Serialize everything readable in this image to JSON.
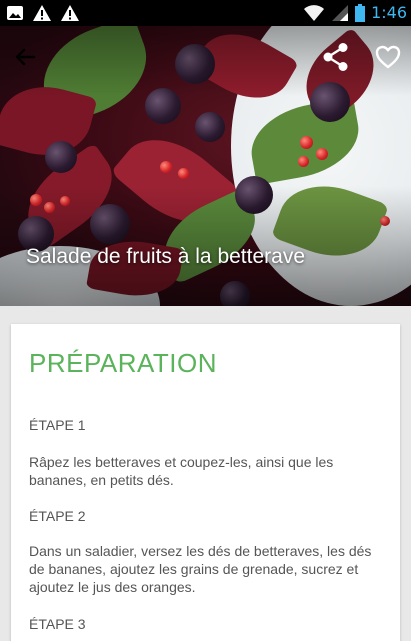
{
  "status_bar": {
    "time": "1:46",
    "icons": [
      "image-icon",
      "warning-icon",
      "warning-icon",
      "wifi-icon",
      "signal-icon",
      "battery-icon"
    ],
    "clock_color": "#3fb7f0"
  },
  "toolbar": {
    "back_icon": "arrow-left-icon",
    "share_icon": "share-icon",
    "favorite_icon": "heart-outline-icon"
  },
  "recipe": {
    "title": "Salade de fruits à la betterave"
  },
  "preparation": {
    "heading": "PRÉPARATION",
    "accent_color": "#5bb35b",
    "steps": [
      {
        "label": "ÉTAPE 1",
        "text": "Râpez les betteraves et coupez-les, ainsi que les bananes, en petits dés."
      },
      {
        "label": "ÉTAPE 2",
        "text": "Dans un saladier, versez les dés de betteraves, les dés de bananes, ajoutez les grains de grenade, sucrez et ajoutez le jus des oranges."
      },
      {
        "label": "ÉTAPE 3",
        "text": ""
      }
    ]
  }
}
